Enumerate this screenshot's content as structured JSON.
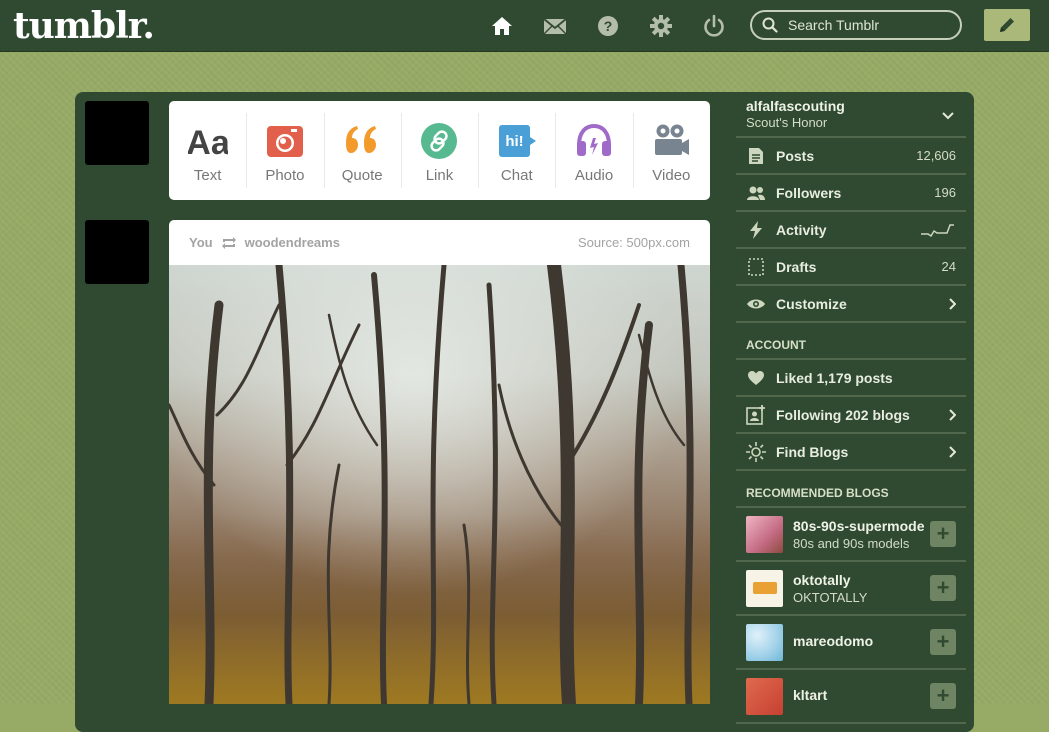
{
  "header": {
    "logo": "tumblr.",
    "search_placeholder": "Search Tumblr",
    "nav": [
      "home-icon",
      "messages-icon",
      "help-icon",
      "settings-icon",
      "logout-icon"
    ]
  },
  "post_types": [
    {
      "label": "Text",
      "icon": "text-icon",
      "color": "#444444"
    },
    {
      "label": "Photo",
      "icon": "camera-icon",
      "color": "#e2604b"
    },
    {
      "label": "Quote",
      "icon": "quote-icon",
      "color": "#f39a2c"
    },
    {
      "label": "Link",
      "icon": "link-icon",
      "color": "#56b98f"
    },
    {
      "label": "Chat",
      "icon": "chat-icon",
      "color": "#4aa0d6"
    },
    {
      "label": "Audio",
      "icon": "headphones-icon",
      "color": "#a06bc8"
    },
    {
      "label": "Video",
      "icon": "video-camera-icon",
      "color": "#788590"
    }
  ],
  "post": {
    "author": "You",
    "reblogged_from": "woodendreams",
    "source": "Source: 500px.com"
  },
  "sidebar": {
    "blog_name": "alfalfascouting",
    "blog_title": "Scout's Honor",
    "stats": [
      {
        "label": "Posts",
        "value": "12,606",
        "icon": "posts-icon"
      },
      {
        "label": "Followers",
        "value": "196",
        "icon": "followers-icon"
      },
      {
        "label": "Activity",
        "value": "",
        "icon": "activity-icon"
      },
      {
        "label": "Drafts",
        "value": "24",
        "icon": "drafts-icon"
      },
      {
        "label": "Customize",
        "value": "",
        "icon": "eye-icon"
      }
    ],
    "account_header": "ACCOUNT",
    "account": [
      {
        "label": "Liked 1,179 posts",
        "icon": "heart-icon"
      },
      {
        "label": "Following 202 blogs",
        "icon": "following-icon"
      },
      {
        "label": "Find Blogs",
        "icon": "find-blogs-icon"
      }
    ],
    "recommended_header": "RECOMMENDED BLOGS",
    "recommended": [
      {
        "name": "80s-90s-supermode",
        "desc": "80s and 90s models",
        "thumb_color": "#d68aa0"
      },
      {
        "name": "oktotally",
        "desc": "OKTOTALLY",
        "thumb_color": "#f7f3e6"
      },
      {
        "name": "mareodomo",
        "desc": "",
        "thumb_color": "#9fd0e8"
      },
      {
        "name": "kltart",
        "desc": "",
        "thumb_color": "#c64032"
      }
    ]
  },
  "colors": {
    "background": "#97ab66",
    "panel": "#2f4a30",
    "accent_button": "#aab87a"
  }
}
